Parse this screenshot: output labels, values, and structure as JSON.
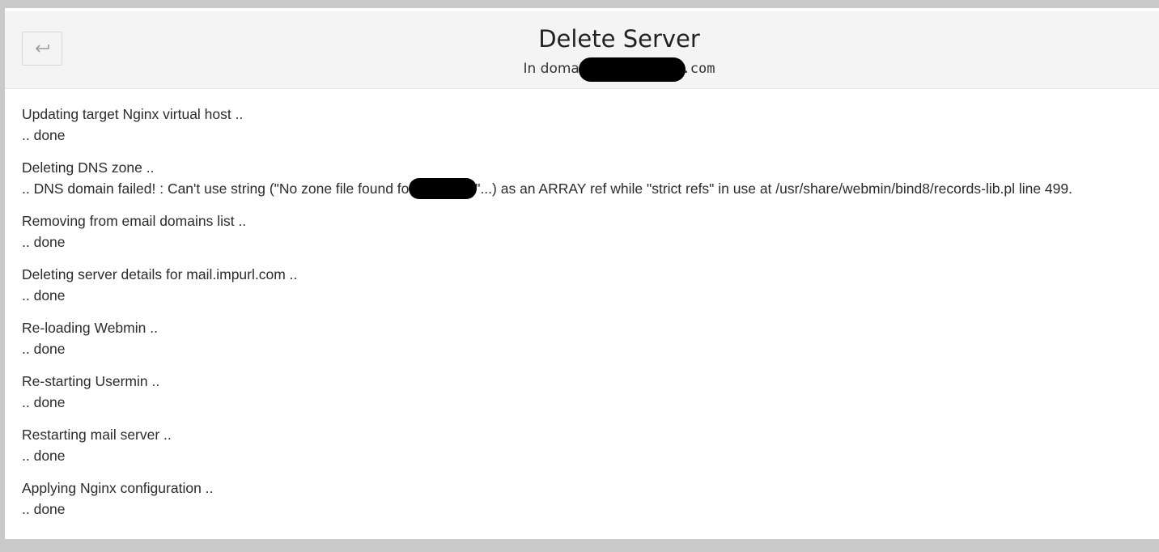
{
  "header": {
    "title": "Delete Server",
    "subtitle_prefix": "In domai",
    "subtitle_suffix": ".com",
    "back_icon": "return-arrow-icon"
  },
  "log": [
    {
      "message": "Updating target Nginx virtual host ..",
      "result": ".. done"
    },
    {
      "message": "Deleting DNS zone ..",
      "result_before": ".. DNS domain failed! : Can't use string (\"No zone file found for",
      "result_after": "\"...) as an ARRAY ref while \"strict refs\" in use at /usr/share/webmin/bind8/records-lib.pl line 499."
    },
    {
      "message": "Removing from email domains list ..",
      "result": ".. done"
    },
    {
      "message": "Deleting server details for mail.impurl.com ..",
      "result": ".. done"
    },
    {
      "message": "Re-loading Webmin ..",
      "result": ".. done"
    },
    {
      "message": "Re-starting Usermin ..",
      "result": ".. done"
    },
    {
      "message": "Restarting mail server ..",
      "result": ".. done"
    },
    {
      "message": "Applying Nginx configuration ..",
      "result": ".. done"
    }
  ],
  "colors": {
    "background": "#c8c9c8",
    "header": "#f3f4f3",
    "text": "#2b2b2b"
  }
}
